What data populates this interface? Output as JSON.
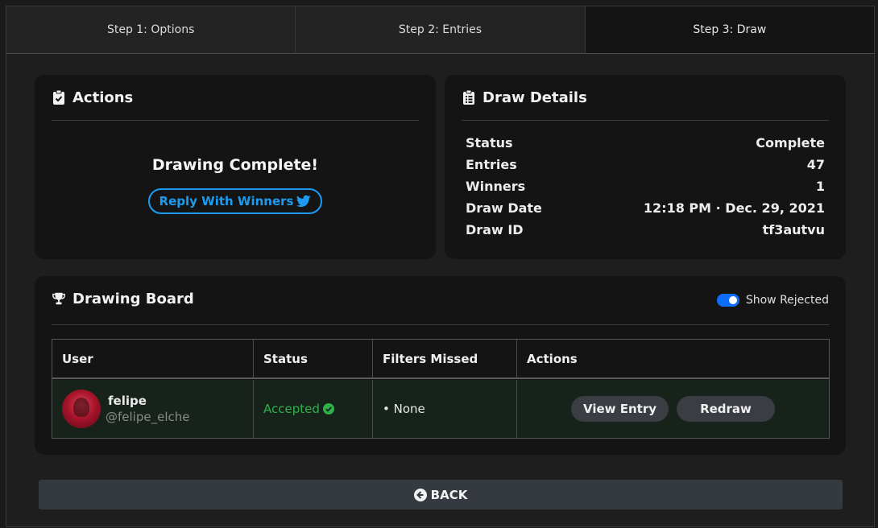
{
  "tabs": [
    {
      "label": "Step 1: Options"
    },
    {
      "label": "Step 2: Entries"
    },
    {
      "label": "Step 3: Draw"
    }
  ],
  "actions": {
    "title": "Actions",
    "icon": "clipboard-check-icon",
    "complete_text": "Drawing Complete!",
    "reply_label": "Reply With Winners",
    "reply_icon": "twitter-icon",
    "accent": "#1d9bf0"
  },
  "details": {
    "title": "Draw Details",
    "icon": "clipboard-list-icon",
    "rows": [
      {
        "label": "Status",
        "value": "Complete"
      },
      {
        "label": "Entries",
        "value": "47"
      },
      {
        "label": "Winners",
        "value": "1"
      },
      {
        "label": "Draw Date",
        "value": "12:18 PM · Dec. 29, 2021"
      },
      {
        "label": "Draw ID",
        "value": "tf3autvu"
      }
    ]
  },
  "board": {
    "title": "Drawing Board",
    "icon": "trophy-icon",
    "toggle_label": "Show Rejected",
    "toggle_on": true,
    "columns": [
      "User",
      "Status",
      "Filters Missed",
      "Actions"
    ],
    "rows": [
      {
        "name": "felipe",
        "handle": "@felipe_elche",
        "status": "Accepted",
        "status_color": "#2fb14a",
        "filters": "• None",
        "view_label": "View Entry",
        "redraw_label": "Redraw"
      }
    ]
  },
  "back_label": "BACK"
}
